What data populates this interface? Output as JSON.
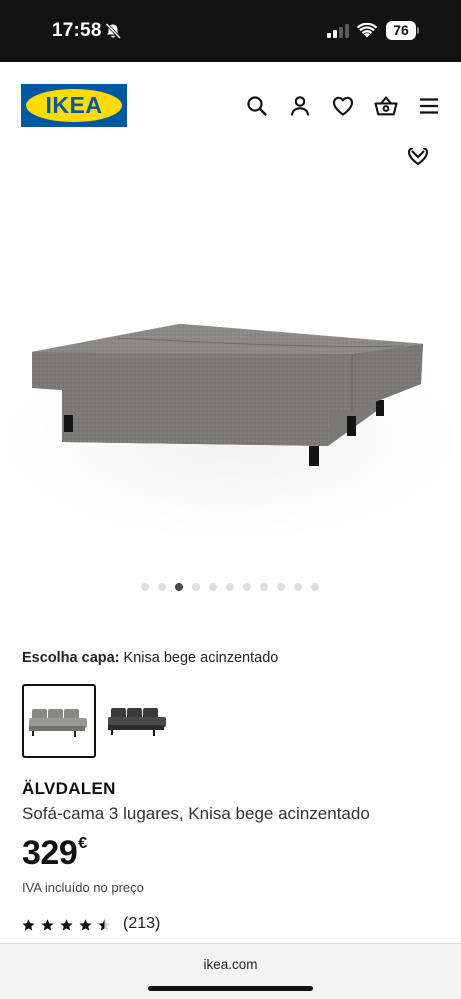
{
  "status_bar": {
    "time": "17:58",
    "battery": "76",
    "icons": [
      "bell-slash-icon",
      "cellular-signal-icon",
      "wifi-icon",
      "battery-icon"
    ]
  },
  "header": {
    "logo_text": "IKEA",
    "icons": [
      "search-icon",
      "user-icon",
      "heart-icon",
      "basket-icon",
      "menu-icon"
    ],
    "brand_colors": {
      "blue": "#0058a3",
      "yellow": "#ffdb00"
    }
  },
  "gallery": {
    "image_count": 11,
    "active_index": 2,
    "image_alt": "sofa-bed-grey-unfolded"
  },
  "product": {
    "cover_label": "Escolha capa:",
    "cover_value": "Knisa bege acinzentado",
    "swatches": [
      {
        "name": "Knisa bege acinzentado",
        "color": "#8a8884",
        "selected": true
      },
      {
        "name": "dark grey",
        "color": "#3a3a3c",
        "selected": false
      }
    ],
    "name": "ÄLVDALEN",
    "description": "Sofá-cama 3 lugares, Knisa bege acinzentado",
    "price_integer": "329",
    "price_currency": "€",
    "vat_note": "IVA incluído no preço",
    "rating_stars": 4.5,
    "rating_count": "(213)"
  },
  "browser": {
    "url": "ikea.com"
  }
}
